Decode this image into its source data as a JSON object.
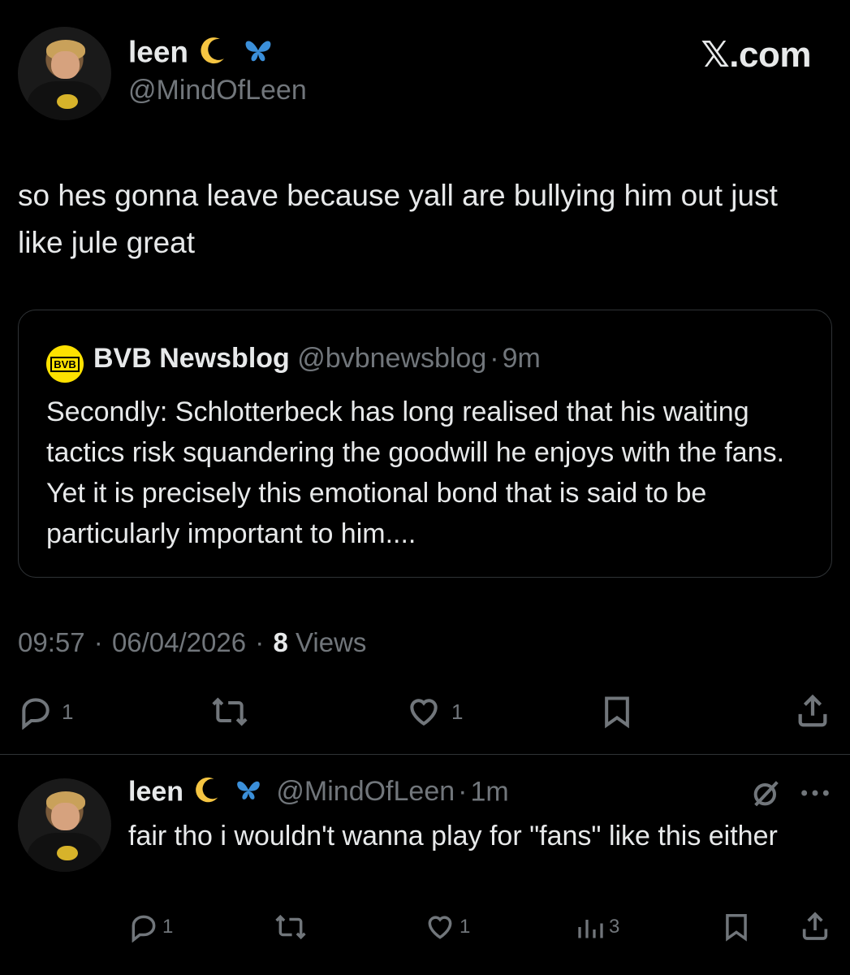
{
  "logo": {
    "text": "𝕏.com"
  },
  "tweet": {
    "author_name": "leen",
    "author_handle": "@MindOfLeen",
    "text": "so hes gonna leave because yall are bullying him out just like jule great",
    "quote": {
      "name": "BVB Newsblog",
      "logo_text": "BVB",
      "handle": "@bvbnewsblog",
      "separator": "·",
      "time": "9m",
      "text": "Secondly: Schlotterbeck has long realised that his waiting tactics risk squandering the goodwill he enjoys with the fans. Yet it is precisely this emotional bond that is said to be particularly important to him...."
    },
    "time": "09:57",
    "date": "06/04/2026",
    "views_count": "8",
    "views_label": "Views",
    "sep": "·",
    "actions": {
      "replies": "1",
      "likes": "1"
    },
    "colors": {
      "moon": "#f5c542",
      "butterfly": "#3b8fd9"
    }
  },
  "reply": {
    "author_name": "leen",
    "author_handle": "@MindOfLeen",
    "separator": "·",
    "time": "1m",
    "text": "fair tho i wouldn't wanna play for \"fans\" like this either",
    "actions": {
      "replies": "1",
      "likes": "1",
      "views": "3"
    }
  }
}
